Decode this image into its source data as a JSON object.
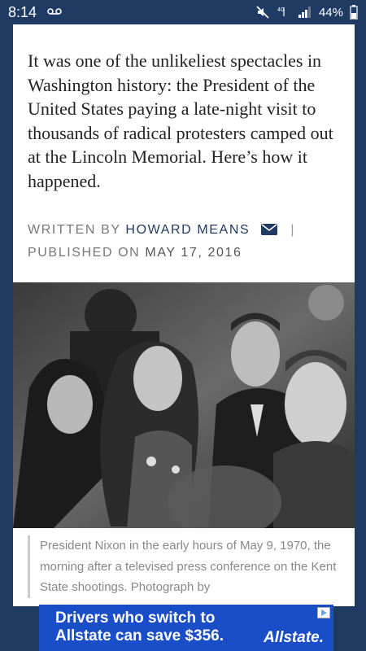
{
  "status_bar": {
    "time": "8:14",
    "voicemail_icon": "voicemail-icon",
    "network": "4G LTE",
    "battery": "44%"
  },
  "article": {
    "intro": "It was one of the unlikeliest spectacles in Washington history: the President of the United States paying a late-night visit to thousands of radical protesters camped out at the Lincoln Memorial. Here’s how it happened.",
    "written_by_label": "WRITTEN BY",
    "author": "HOWARD MEANS",
    "separator": "|",
    "published_label": "PUBLISHED ON",
    "date": "MAY 17, 2016",
    "caption": "President Nixon in the early hours of May 9, 1970, the morning after a televised press conference on the Kent State shootings. Photograph by"
  },
  "ad": {
    "line1": "Drivers who switch to",
    "line2": "Allstate can save $356.",
    "brand": "Allstate."
  },
  "colors": {
    "navy": "#1f3b63",
    "ad_blue": "#1a4ec8"
  }
}
